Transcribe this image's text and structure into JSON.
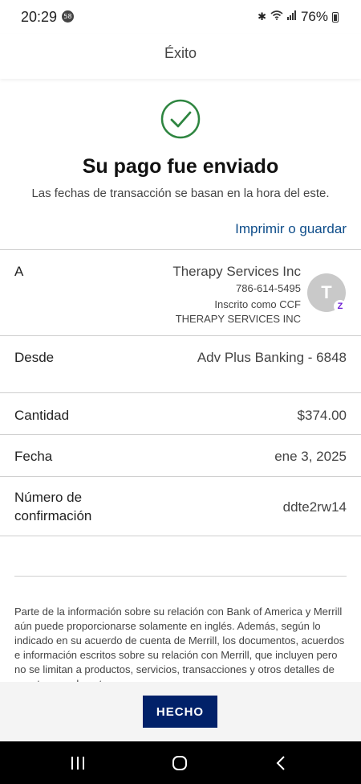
{
  "status_bar": {
    "time": "20:29",
    "notification_count": "58",
    "battery": "76%"
  },
  "header": {
    "title": "Éxito"
  },
  "success": {
    "headline": "Su pago fue enviado",
    "subtext": "Las fechas de transacción se basan en la hora del este.",
    "print_link": "Imprimir o guardar"
  },
  "details": {
    "to": {
      "label": "A",
      "name": "Therapy Services Inc",
      "phone": "786-614-5495",
      "enrolled": "Inscrito como CCF",
      "legal_name": "THERAPY SERVICES INC",
      "avatar_initial": "T",
      "badge": "Z"
    },
    "from": {
      "label": "Desde",
      "value": "Adv Plus Banking - 6848"
    },
    "amount": {
      "label": "Cantidad",
      "value": "$374.00"
    },
    "date": {
      "label": "Fecha",
      "value": "ene 3, 2025"
    },
    "confirmation": {
      "label_line1": "Número de",
      "label_line2": "confirmación",
      "value": "ddte2rw14"
    }
  },
  "disclaimer": "Parte de la información sobre su relación con Bank of America y Merrill aún puede proporcionarse solamente en inglés. Además, según lo indicado en su acuerdo de cuenta de Merrill, los documentos, acuerdos e información escritos sobre su relación con Merrill, que incluyen pero no se limitan a productos, servicios, transacciones y otros detalles de cuentas usualmente",
  "footer": {
    "done_label": "HECHO"
  },
  "colors": {
    "brand_navy": "#012169",
    "link_blue": "#0e4d8a",
    "success_green": "#2e8540",
    "zelle_purple": "#6d1ed4"
  }
}
